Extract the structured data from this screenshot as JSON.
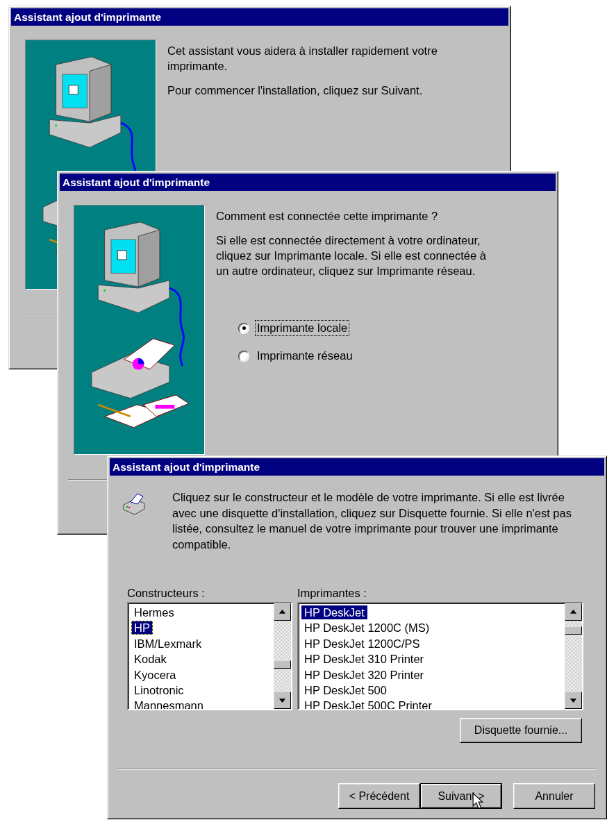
{
  "windows": [
    {
      "kind": "welcome",
      "title": "Assistant ajout d'imprimante",
      "paragraphs": [
        "Cet assistant vous aidera à installer rapidement votre imprimante.",
        "Pour commencer l'installation, cliquez sur Suivant."
      ]
    },
    {
      "kind": "connection",
      "title": "Assistant ajout d'imprimante",
      "paragraphs": [
        "Comment est connectée cette imprimante ?",
        "Si elle est connectée directement à votre ordinateur, cliquez sur Imprimante locale. Si elle est connectée à un autre ordinateur, cliquez  sur Imprimante réseau."
      ],
      "options": [
        {
          "label": "Imprimante locale",
          "selected": true
        },
        {
          "label": "Imprimante réseau",
          "selected": false
        }
      ]
    },
    {
      "kind": "model",
      "title": "Assistant ajout d'imprimante",
      "paragraphs": [
        "Cliquez sur le constructeur et le modèle de votre imprimante. Si elle est livrée avec une disquette d'installation, cliquez sur Disquette fournie. Si elle n'est pas listée, consultez le manuel de votre imprimante pour trouver une imprimante compatible."
      ],
      "lists": [
        {
          "label": "Constructeurs :",
          "items": [
            {
              "label": "Hermes",
              "selected": false
            },
            {
              "label": "HP",
              "selected": true
            },
            {
              "label": "IBM/Lexmark",
              "selected": false
            },
            {
              "label": "Kodak",
              "selected": false
            },
            {
              "label": "Kyocera",
              "selected": false
            },
            {
              "label": "Linotronic",
              "selected": false
            },
            {
              "label": "Mannesmann",
              "selected": false
            }
          ]
        },
        {
          "label": "Imprimantes :",
          "items": [
            {
              "label": "HP DeskJet",
              "selected": true
            },
            {
              "label": "HP DeskJet 1200C (MS)",
              "selected": false
            },
            {
              "label": "HP DeskJet 1200C/PS",
              "selected": false
            },
            {
              "label": "HP DeskJet 310 Printer",
              "selected": false
            },
            {
              "label": "HP DeskJet 320 Printer",
              "selected": false
            },
            {
              "label": "HP DeskJet 500",
              "selected": false
            },
            {
              "label": "HP DeskJet 500C Printer",
              "selected": false
            }
          ]
        }
      ],
      "disk_button": "Disquette fournie...",
      "nav_buttons": [
        {
          "label": "< Précédent",
          "default": false
        },
        {
          "label": "Suivant >",
          "default": true
        },
        {
          "label": "Annuler",
          "default": false
        }
      ]
    }
  ]
}
